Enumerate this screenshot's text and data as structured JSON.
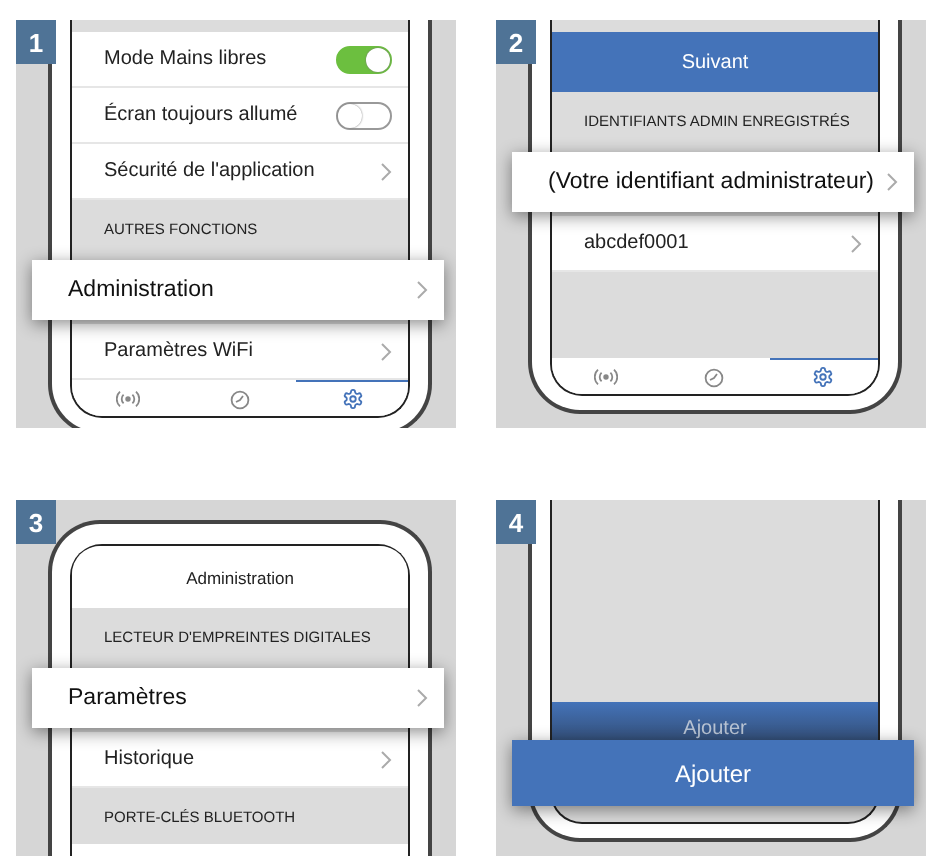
{
  "steps": [
    {
      "number": "1",
      "kind": "phone-bottom",
      "items": [
        {
          "kind": "toggle",
          "label": "Mode Mains libres",
          "on": true
        },
        {
          "kind": "toggle",
          "label": "Écran toujours allumé",
          "on": false
        },
        {
          "kind": "link",
          "label": "Sécurité de l'application"
        },
        {
          "kind": "section",
          "label": "AUTRES FONCTIONS"
        },
        {
          "kind": "callout",
          "label": "Administration"
        },
        {
          "kind": "link",
          "label": "Paramètres WiFi"
        },
        {
          "kind": "spacer"
        }
      ],
      "tabs": [
        {
          "kind": "signal",
          "selected": false
        },
        {
          "kind": "gauge",
          "selected": false
        },
        {
          "kind": "settings",
          "selected": true
        }
      ]
    },
    {
      "number": "2",
      "kind": "phone-bottom",
      "items": [
        {
          "kind": "button",
          "label": "Suivant"
        },
        {
          "kind": "section",
          "label": "IDENTIFIANTS ADMIN ENREGISTRÉS"
        },
        {
          "kind": "callout",
          "label": "(Votre identifiant administrateur)"
        },
        {
          "kind": "link",
          "label": "abcdef0001"
        },
        {
          "kind": "spacer"
        }
      ],
      "tabs": [
        {
          "kind": "signal",
          "selected": false
        },
        {
          "kind": "gauge",
          "selected": false
        },
        {
          "kind": "settings",
          "selected": true
        }
      ]
    },
    {
      "number": "3",
      "kind": "phone-top",
      "items": [
        {
          "kind": "title",
          "label": "Administration"
        },
        {
          "kind": "section",
          "label": "LECTEUR D'EMPREINTES DIGITALES"
        },
        {
          "kind": "callout",
          "label": "Paramètres"
        },
        {
          "kind": "link",
          "label": "Historique"
        },
        {
          "kind": "section",
          "label": "PORTE-CLÉS BLUETOOTH"
        },
        {
          "kind": "blank"
        }
      ]
    },
    {
      "number": "4",
      "kind": "phone-bottom",
      "items": [
        {
          "kind": "spacer"
        },
        {
          "kind": "dimbutton",
          "label": "Ajouter"
        },
        {
          "kind": "calloutbutton",
          "label": "Ajouter"
        }
      ]
    }
  ]
}
